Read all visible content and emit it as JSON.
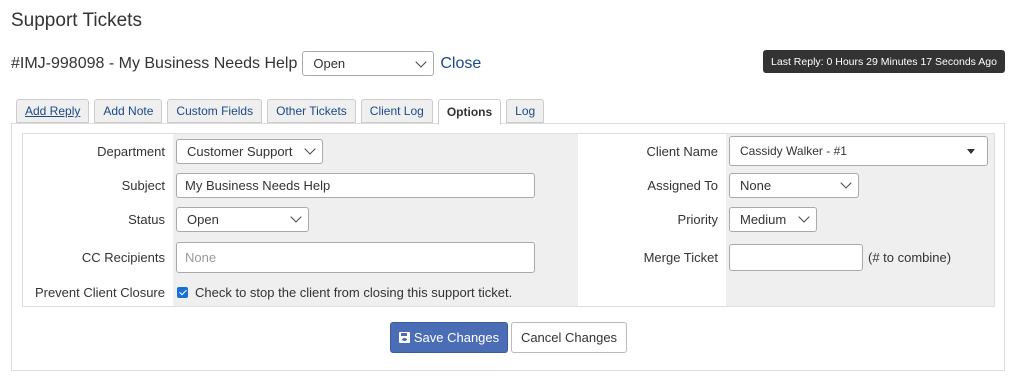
{
  "page": {
    "title": "Support Tickets"
  },
  "ticket": {
    "title": "#IMJ-998098 - My Business Needs Help",
    "status": "Open",
    "close_label": "Close",
    "last_reply": "Last Reply: 0 Hours 29 Minutes 17 Seconds Ago"
  },
  "tabs": [
    {
      "label": "Add Reply"
    },
    {
      "label": "Add Note"
    },
    {
      "label": "Custom Fields"
    },
    {
      "label": "Other Tickets"
    },
    {
      "label": "Client Log"
    },
    {
      "label": "Options"
    },
    {
      "label": "Log"
    }
  ],
  "active_tab": "Options",
  "form": {
    "department": {
      "label": "Department",
      "value": "Customer Support"
    },
    "subject": {
      "label": "Subject",
      "value": "My Business Needs Help"
    },
    "status": {
      "label": "Status",
      "value": "Open"
    },
    "cc": {
      "label": "CC Recipients",
      "placeholder": "None"
    },
    "prevent": {
      "label": "Prevent Client Closure",
      "text": "Check to stop the client from closing this support ticket.",
      "checked": true
    },
    "client": {
      "label": "Client Name",
      "value": "Cassidy Walker - #1"
    },
    "assigned": {
      "label": "Assigned To",
      "value": "None"
    },
    "priority": {
      "label": "Priority",
      "value": "Medium"
    },
    "merge": {
      "label": "Merge Ticket",
      "hint": "(# to combine)"
    }
  },
  "buttons": {
    "save": "Save Changes",
    "cancel": "Cancel Changes"
  },
  "colors": {
    "primary": "#4a6db5",
    "link": "#1a4a8a",
    "badge": "#333333",
    "checkbox": "#1a6fd4"
  }
}
